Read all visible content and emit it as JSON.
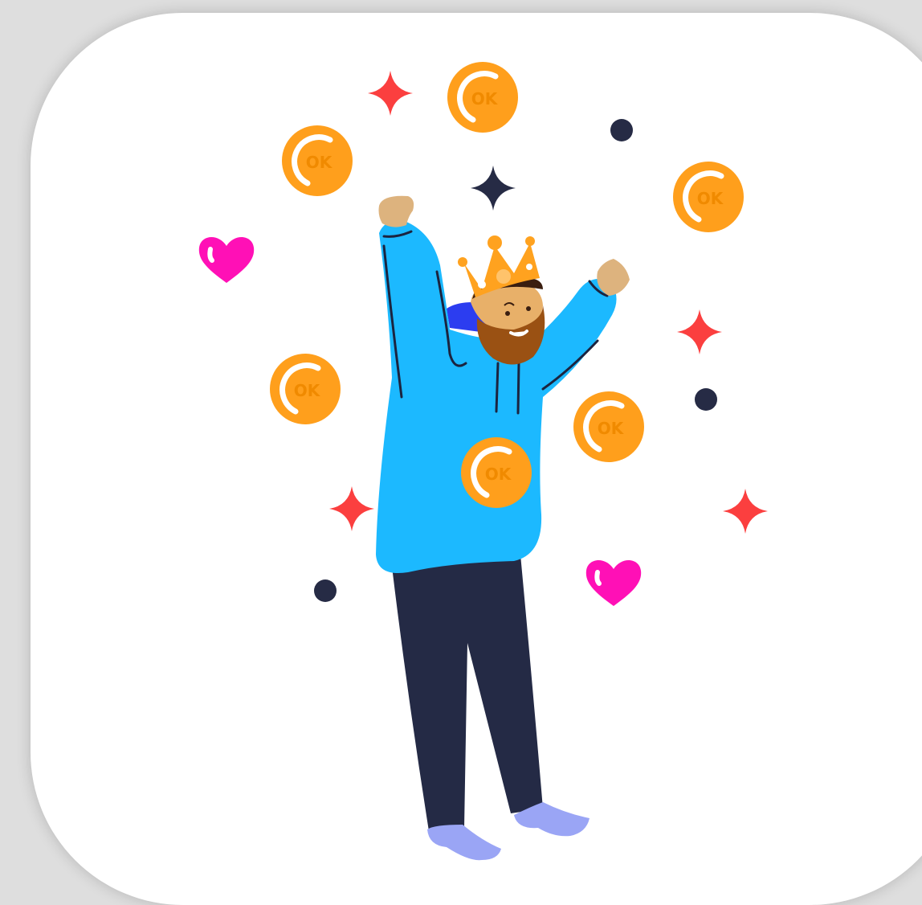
{
  "illustration": {
    "subject": "celebrating man with crown, hoodie and beard",
    "coin_label": "OK",
    "colors": {
      "background": "#dedede",
      "card": "#ffffff",
      "coin": "#ff9f1c",
      "coin_text": "#f08a00",
      "coin_ring": "#ffffff",
      "hoodie": "#1cb9ff",
      "pants": "#242a45",
      "socks": "#9aa5f5",
      "skin": "#e8b069",
      "hand": "#ddb37e",
      "beard": "#9a5113",
      "crown": "#ffa21f",
      "red_sparkle": "#fb3f3f",
      "dark_sparkle": "#262b45",
      "heart": "#ff10b6",
      "dot": "#262b45"
    }
  }
}
